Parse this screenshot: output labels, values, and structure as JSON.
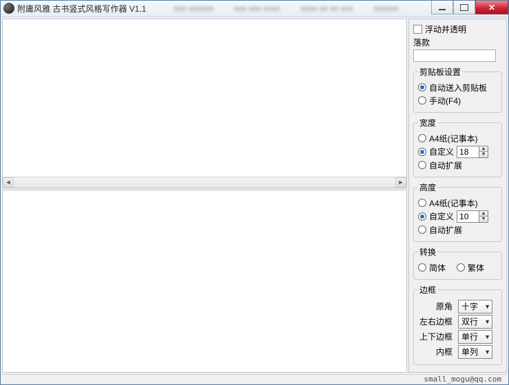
{
  "window": {
    "title": "附庸风雅 古书竖式风格写作器 V1.1"
  },
  "sidebar": {
    "float_transparent": "浮动并透明",
    "signature_label": "落款",
    "signature_value": "",
    "clipboard": {
      "legend": "剪贴板设置",
      "auto": "自动送入剪贴板",
      "manual": "手动(F4)",
      "selected": "auto"
    },
    "width": {
      "legend": "宽度",
      "a4": "A4纸(记事本)",
      "custom": "自定义",
      "custom_value": "18",
      "auto": "自动扩展",
      "selected": "custom"
    },
    "height": {
      "legend": "高度",
      "a4": "A4纸(记事本)",
      "custom": "自定义",
      "custom_value": "10",
      "auto": "自动扩展",
      "selected": "custom"
    },
    "convert": {
      "legend": "转换",
      "simplified": "简体",
      "traditional": "繁体",
      "selected": ""
    },
    "border": {
      "legend": "边框",
      "corner_label": "原角",
      "corner_value": "十字",
      "lr_label": "左右边框",
      "lr_value": "双行",
      "tb_label": "上下边框",
      "tb_value": "单行",
      "inner_label": "内框",
      "inner_value": "单列"
    }
  },
  "footer": {
    "email": "small_mogu@qq.com"
  }
}
